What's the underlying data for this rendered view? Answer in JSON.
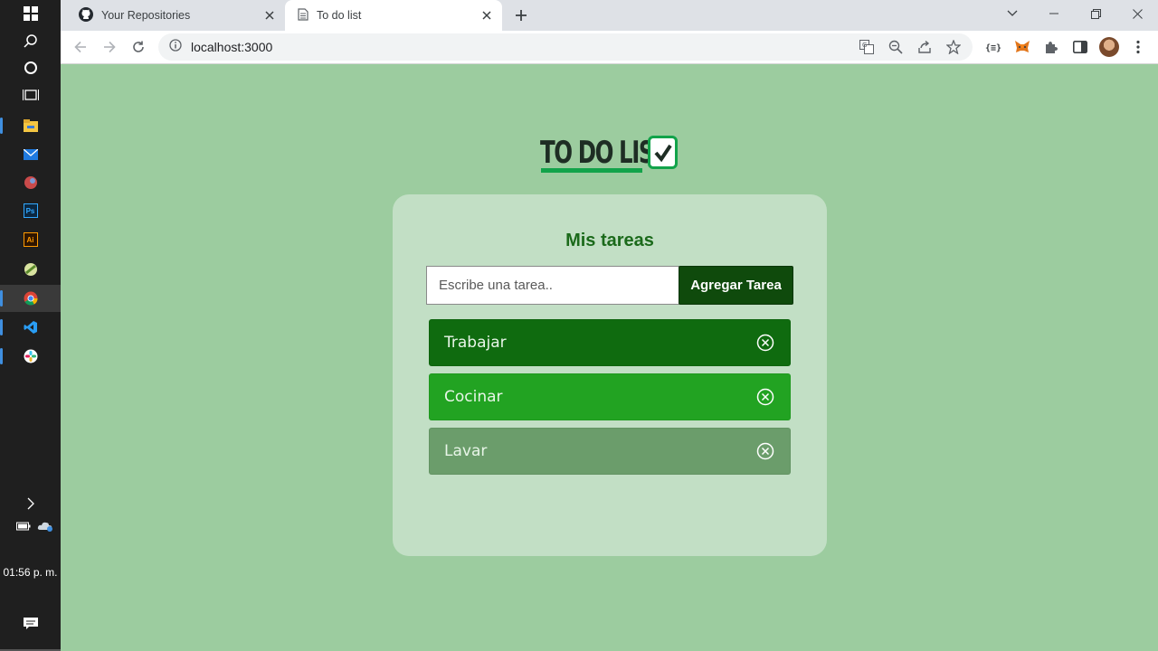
{
  "browser": {
    "tabs": [
      {
        "title": "Your Repositories",
        "icon": "github-icon",
        "active": false
      },
      {
        "title": "To do list",
        "icon": "page-icon",
        "active": true
      }
    ],
    "url": "localhost:3000"
  },
  "taskbar": {
    "apps": [
      "windows-start-icon",
      "search-icon",
      "cortana-icon",
      "task-view-icon",
      "file-explorer-icon",
      "mail-icon",
      "app-icon",
      "photoshop-icon",
      "illustrator-icon",
      "app-icon",
      "chrome-icon",
      "vscode-icon",
      "slack-icon"
    ],
    "time": "01:56 p. m."
  },
  "app": {
    "logo_text": "TO DO LIST",
    "card_title": "Mis tareas",
    "input_placeholder": "Escribe una tarea..",
    "add_button": "Agregar Tarea",
    "tasks": [
      {
        "label": "Trabajar",
        "color": "#0f6b0f"
      },
      {
        "label": "Cocinar",
        "color": "#22a322"
      },
      {
        "label": "Lavar",
        "color": "#6b9d6b"
      }
    ]
  },
  "colors": {
    "page_bg": "#9ccc9f",
    "card_bg": "#c2dfc5",
    "accent": "#12a34a",
    "button_bg": "#0f4a0c",
    "title_color": "#1b6a1b"
  }
}
